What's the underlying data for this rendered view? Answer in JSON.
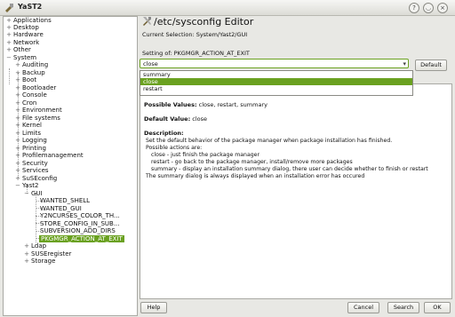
{
  "window": {
    "title": "YaST2",
    "buttons": [
      "?",
      "◡",
      "×"
    ]
  },
  "tree": {
    "items": [
      {
        "label": "Applications",
        "expander": "+"
      },
      {
        "label": "Desktop",
        "expander": "+"
      },
      {
        "label": "Hardware",
        "expander": "+"
      },
      {
        "label": "Network",
        "expander": "+"
      },
      {
        "label": "Other",
        "expander": "+"
      },
      {
        "label": "System",
        "expander": "−"
      },
      {
        "label": "Auditing",
        "expander": "+"
      },
      {
        "label": "Backup",
        "expander": "+"
      },
      {
        "label": "Boot",
        "expander": "+"
      },
      {
        "label": "Bootloader",
        "expander": "+"
      },
      {
        "label": "Console",
        "expander": "+"
      },
      {
        "label": "Cron",
        "expander": "+"
      },
      {
        "label": "Environment",
        "expander": "+"
      },
      {
        "label": "File systems",
        "expander": "+"
      },
      {
        "label": "Kernel",
        "expander": "+"
      },
      {
        "label": "Limits",
        "expander": "+"
      },
      {
        "label": "Logging",
        "expander": "+"
      },
      {
        "label": "Printing",
        "expander": "+"
      },
      {
        "label": "Profilemanagement",
        "expander": "+"
      },
      {
        "label": "Security",
        "expander": "+"
      },
      {
        "label": "Services",
        "expander": "+"
      },
      {
        "label": "SuSEconfig",
        "expander": "+"
      },
      {
        "label": "Yast2",
        "expander": "−"
      },
      {
        "label": "GUI",
        "expander": "−"
      },
      {
        "label": "WANTED_SHELL",
        "expander": ""
      },
      {
        "label": "WANTED_GUI",
        "expander": ""
      },
      {
        "label": "Y2NCURSES_COLOR_TH...",
        "expander": ""
      },
      {
        "label": "STORE_CONFIG_IN_SUB...",
        "expander": ""
      },
      {
        "label": "SUBVERSION_ADD_DIRS",
        "expander": ""
      },
      {
        "label": "PKGMGR_ACTION_AT_EXIT",
        "expander": ""
      },
      {
        "label": "Ldap",
        "expander": "+"
      },
      {
        "label": "SUSEregister",
        "expander": "+"
      },
      {
        "label": "Storage",
        "expander": "+"
      }
    ]
  },
  "editor": {
    "title": "/etc/sysconfig Editor",
    "current_selection": "Current Selection: System/Yast2/GUI",
    "setting_label": "Setting of: PKGMGR_ACTION_AT_EXIT",
    "combo_value": "close",
    "default_button": "Default",
    "dropdown_options": [
      "summary",
      "close",
      "restart"
    ],
    "selected_option": "close"
  },
  "info": {
    "possible_label": "Possible Values:",
    "possible_values": "close, restart, summary",
    "default_label": "Default Value:",
    "default_value": "close",
    "description_label": "Description:",
    "description_lines": [
      "Set the default behavior of the package manager when package installation has finished.",
      "Possible actions are:",
      "close - just finish the package manager",
      "restart - go back to the package manager, install/remove more packages",
      "summary - display an installation summary dialog, there user can decide whether to finish or restart",
      "The summary dialog is always displayed when an installation error has occured"
    ]
  },
  "footer": {
    "help": "Help",
    "cancel": "Cancel",
    "search": "Search",
    "ok": "OK"
  },
  "colors": {
    "accent": "#6aa120"
  }
}
